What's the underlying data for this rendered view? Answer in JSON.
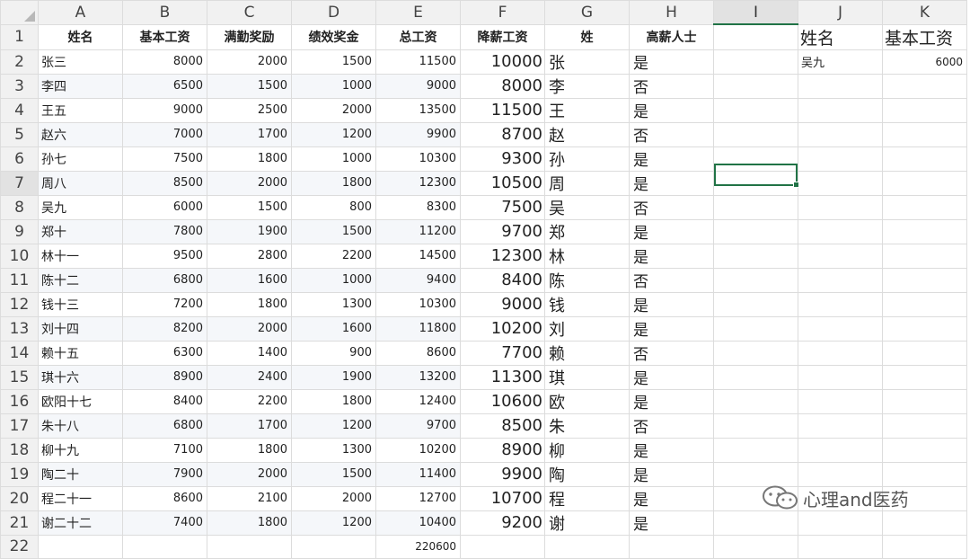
{
  "columns": [
    "A",
    "B",
    "C",
    "D",
    "E",
    "F",
    "G",
    "H",
    "I",
    "J",
    "K"
  ],
  "headers": {
    "name": "姓名",
    "base": "基本工资",
    "attendance": "满勤奖励",
    "performance": "绩效奖金",
    "total": "总工资",
    "reduced": "降薪工资",
    "surname": "姓",
    "high": "高薪人士"
  },
  "rows": [
    {
      "n": "2",
      "name": "张三",
      "base": "8000",
      "att": "2000",
      "perf": "1500",
      "total": "11500",
      "red": "10000",
      "sur": "张",
      "high": "是"
    },
    {
      "n": "3",
      "name": "李四",
      "base": "6500",
      "att": "1500",
      "perf": "1000",
      "total": "9000",
      "red": "8000",
      "sur": "李",
      "high": "否"
    },
    {
      "n": "4",
      "name": "王五",
      "base": "9000",
      "att": "2500",
      "perf": "2000",
      "total": "13500",
      "red": "11500",
      "sur": "王",
      "high": "是"
    },
    {
      "n": "5",
      "name": "赵六",
      "base": "7000",
      "att": "1700",
      "perf": "1200",
      "total": "9900",
      "red": "8700",
      "sur": "赵",
      "high": "否"
    },
    {
      "n": "6",
      "name": "孙七",
      "base": "7500",
      "att": "1800",
      "perf": "1000",
      "total": "10300",
      "red": "9300",
      "sur": "孙",
      "high": "是"
    },
    {
      "n": "7",
      "name": "周八",
      "base": "8500",
      "att": "2000",
      "perf": "1800",
      "total": "12300",
      "red": "10500",
      "sur": "周",
      "high": "是"
    },
    {
      "n": "8",
      "name": "吴九",
      "base": "6000",
      "att": "1500",
      "perf": "800",
      "total": "8300",
      "red": "7500",
      "sur": "吴",
      "high": "否"
    },
    {
      "n": "9",
      "name": "郑十",
      "base": "7800",
      "att": "1900",
      "perf": "1500",
      "total": "11200",
      "red": "9700",
      "sur": "郑",
      "high": "是"
    },
    {
      "n": "10",
      "name": "林十一",
      "base": "9500",
      "att": "2800",
      "perf": "2200",
      "total": "14500",
      "red": "12300",
      "sur": "林",
      "high": "是"
    },
    {
      "n": "11",
      "name": "陈十二",
      "base": "6800",
      "att": "1600",
      "perf": "1000",
      "total": "9400",
      "red": "8400",
      "sur": "陈",
      "high": "否"
    },
    {
      "n": "12",
      "name": "钱十三",
      "base": "7200",
      "att": "1800",
      "perf": "1300",
      "total": "10300",
      "red": "9000",
      "sur": "钱",
      "high": "是"
    },
    {
      "n": "13",
      "name": "刘十四",
      "base": "8200",
      "att": "2000",
      "perf": "1600",
      "total": "11800",
      "red": "10200",
      "sur": "刘",
      "high": "是"
    },
    {
      "n": "14",
      "name": "赖十五",
      "base": "6300",
      "att": "1400",
      "perf": "900",
      "total": "8600",
      "red": "7700",
      "sur": "赖",
      "high": "否"
    },
    {
      "n": "15",
      "name": "琪十六",
      "base": "8900",
      "att": "2400",
      "perf": "1900",
      "total": "13200",
      "red": "11300",
      "sur": "琪",
      "high": "是"
    },
    {
      "n": "16",
      "name": "欧阳十七",
      "base": "8400",
      "att": "2200",
      "perf": "1800",
      "total": "12400",
      "red": "10600",
      "sur": "欧",
      "high": "是"
    },
    {
      "n": "17",
      "name": "朱十八",
      "base": "6800",
      "att": "1700",
      "perf": "1200",
      "total": "9700",
      "red": "8500",
      "sur": "朱",
      "high": "否"
    },
    {
      "n": "18",
      "name": "柳十九",
      "base": "7100",
      "att": "1800",
      "perf": "1300",
      "total": "10200",
      "red": "8900",
      "sur": "柳",
      "high": "是"
    },
    {
      "n": "19",
      "name": "陶二十",
      "base": "7900",
      "att": "2000",
      "perf": "1500",
      "total": "11400",
      "red": "9900",
      "sur": "陶",
      "high": "是"
    },
    {
      "n": "20",
      "name": "程二十一",
      "base": "8600",
      "att": "2100",
      "perf": "2000",
      "total": "12700",
      "red": "10700",
      "sur": "程",
      "high": "是"
    },
    {
      "n": "21",
      "name": "谢二十二",
      "base": "7400",
      "att": "1800",
      "perf": "1200",
      "total": "10400",
      "red": "9200",
      "sur": "谢",
      "high": "是"
    }
  ],
  "total_row": {
    "n": "22",
    "total": "220600"
  },
  "lookup": {
    "name_header": "姓名",
    "salary_header": "基本工资",
    "name_value": "吴九",
    "salary_value": "6000"
  },
  "row1_label": "1",
  "watermark": "心理and医药",
  "colors": {
    "accent": "#217346",
    "header_bg": "#f1f1f1",
    "grid": "#dcdcdc"
  }
}
